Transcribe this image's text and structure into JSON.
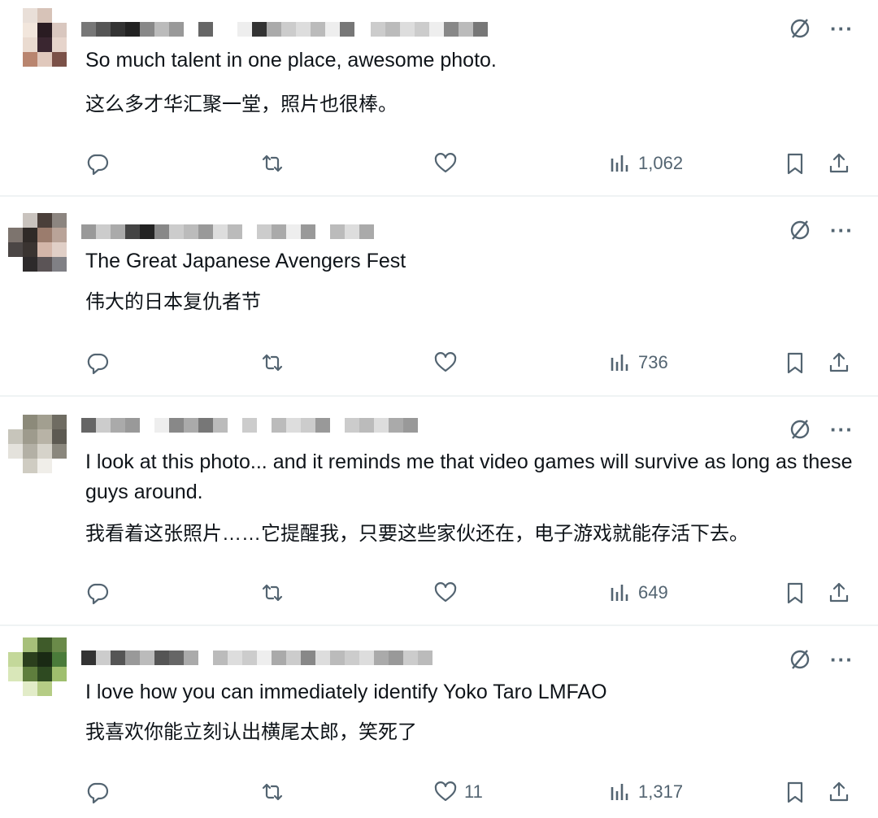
{
  "posts": [
    {
      "text": "So much talent in one place, awesome photo.",
      "translation": "这么多才华汇聚一堂，照片也很棒。",
      "likes": "",
      "views": "1,062"
    },
    {
      "text": "The Great Japanese Avengers Fest",
      "translation": "伟大的日本复仇者节",
      "likes": "",
      "views": "736"
    },
    {
      "text": "I look at this photo... and it reminds me that video games will survive as long as these guys around.",
      "translation": "我看着这张照片……它提醒我，只要这些家伙还在，电子游戏就能存活下去。",
      "likes": "",
      "views": "649"
    },
    {
      "text": "I love how you can immediately identify Yoko Taro LMFAO",
      "translation": "我喜欢你能立刻认出横尾太郎，笑死了",
      "likes": "11",
      "views": "1,317"
    }
  ],
  "icons": {
    "reply": "reply-icon",
    "repost": "repost-icon",
    "like": "heart-icon",
    "views": "views-icon",
    "bookmark": "bookmark-icon",
    "share": "share-icon",
    "hide": "hide-reply-icon",
    "more": "more-icon"
  },
  "colors": {
    "text": "#0f1419",
    "muted": "#536471",
    "separator": "#eff3f4"
  }
}
